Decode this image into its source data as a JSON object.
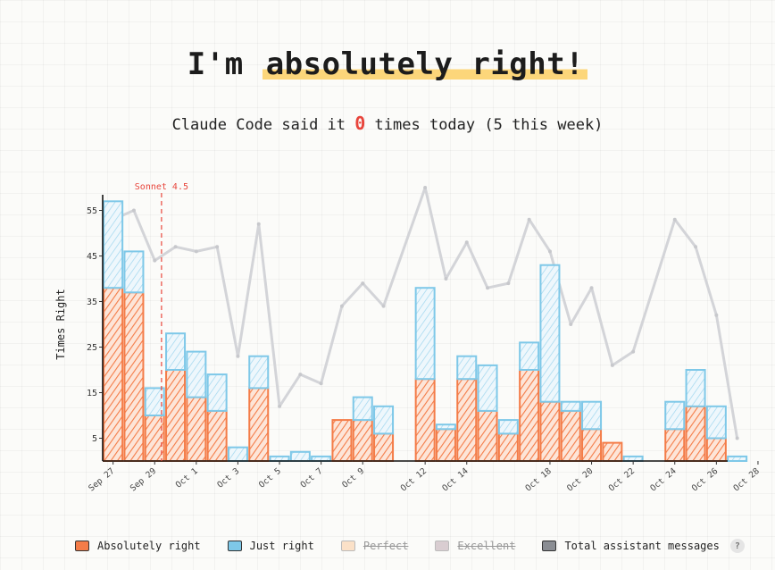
{
  "header": {
    "title_pre": "I'm ",
    "title_highlight": "absolutely right!",
    "subtitle_pre": "Claude Code said it ",
    "subtitle_count": "0",
    "subtitle_post": " times today (5 this week)"
  },
  "legend": {
    "items": [
      {
        "label": "Absolutely right",
        "color": "#f47c48",
        "active": true
      },
      {
        "label": "Just right",
        "color": "#7ec8e8",
        "active": true
      },
      {
        "label": "Perfect",
        "color": "#fbe1c8",
        "active": false
      },
      {
        "label": "Excellent",
        "color": "#d9cdd1",
        "active": false
      },
      {
        "label": "Total assistant messages",
        "color": "#8a8d93",
        "active": true
      }
    ],
    "help": "?"
  },
  "colors": {
    "absolutely": "#f47c48",
    "just": "#7ec8e8",
    "total_line": "#d3d4d8",
    "annotation": "#e8453c",
    "axis": "#111111"
  },
  "chart_data": {
    "type": "bar",
    "stacked": true,
    "categories": [
      "Sep 27",
      "Sep 28",
      "Sep 29",
      "Sep 30",
      "Oct 1",
      "Oct 2",
      "Oct 3",
      "Oct 4",
      "Oct 5",
      "Oct 6",
      "Oct 7",
      "Oct 8",
      "Oct 9",
      "Oct 10",
      "Oct 11",
      "Oct 12",
      "Oct 13",
      "Oct 14",
      "Oct 15",
      "Oct 16",
      "Oct 17",
      "Oct 18",
      "Oct 19",
      "Oct 20",
      "Oct 21",
      "Oct 22",
      "Oct 23",
      "Oct 24",
      "Oct 25",
      "Oct 26",
      "Oct 27",
      "Oct 28",
      "Oct 29"
    ],
    "tick_labels": [
      "Sep 27",
      "Sep 29",
      "Oct 1",
      "Oct 3",
      "Oct 5",
      "Oct 7",
      "Oct 9",
      "Oct 12",
      "Oct 14",
      "Oct 18",
      "Oct 20",
      "Oct 22",
      "Oct 24",
      "Oct 26",
      "Oct 28"
    ],
    "series": [
      {
        "name": "Absolutely right",
        "values": [
          38,
          37,
          10,
          20,
          14,
          11,
          0,
          16,
          0,
          0,
          0,
          9,
          9,
          6,
          18,
          7,
          18,
          11,
          6,
          20,
          13,
          11,
          7,
          4,
          0,
          7,
          12,
          5,
          0
        ]
      },
      {
        "name": "Just right",
        "values": [
          19,
          9,
          6,
          8,
          10,
          8,
          3,
          7,
          1,
          2,
          1,
          0,
          5,
          6,
          20,
          1,
          5,
          10,
          3,
          6,
          30,
          2,
          6,
          0,
          1,
          6,
          8,
          7,
          1
        ]
      },
      {
        "name": "Total assistant messages",
        "type": "line",
        "values": [
          53,
          55,
          44,
          47,
          46,
          47,
          23,
          52,
          12,
          19,
          17,
          34,
          39,
          34,
          60,
          40,
          48,
          38,
          39,
          53,
          46,
          30,
          38,
          21,
          24,
          53,
          47,
          32,
          5
        ]
      }
    ],
    "bar_categories": [
      "Sep 27",
      "Sep 28",
      "Sep 29",
      "Sep 30",
      "Oct 1",
      "Oct 2",
      "Oct 3",
      "Oct 4",
      "Oct 5",
      "Oct 6",
      "Oct 7",
      "Oct 8",
      "Oct 9",
      "Oct 10",
      "Oct 12",
      "Oct 13",
      "Oct 14",
      "Oct 15",
      "Oct 16",
      "Oct 17",
      "Oct 18",
      "Oct 19",
      "Oct 20",
      "Oct 21",
      "Oct 22",
      "Oct 24",
      "Oct 25",
      "Oct 26",
      "Oct 27"
    ],
    "y_ticks": [
      5,
      15,
      25,
      35,
      45,
      55
    ],
    "ylabel": "Times Right",
    "xlabel": "",
    "ylim": [
      0,
      60
    ],
    "annotation": {
      "label": "Sonnet 4.5",
      "between": [
        "Sep 29",
        "Sep 30"
      ],
      "style": "dashed"
    },
    "grid": false
  }
}
